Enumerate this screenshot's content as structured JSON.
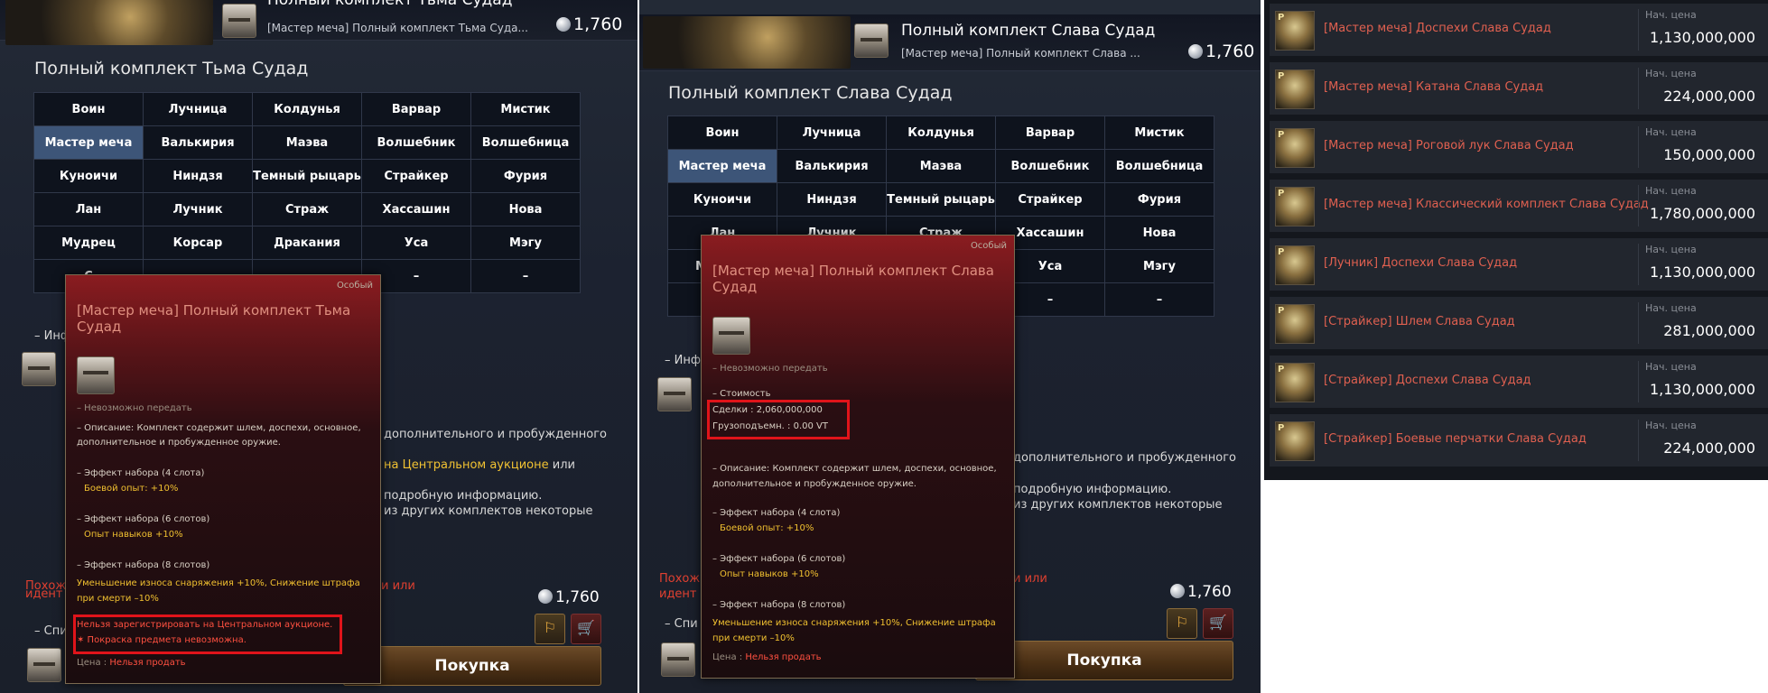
{
  "left_panel": {
    "top_name": "Полный комплект Тьма Судад",
    "top_sub": "[Мастер меча] Полный комплект Тьма Суда...",
    "top_price": "1,760",
    "set_title": "Полный комплект Тьма Судад",
    "classes": [
      [
        "Воин",
        "Лучница",
        "Колдунья",
        "Варвар",
        "Мистик"
      ],
      [
        "Мастер меча",
        "Валькирия",
        "Маэва",
        "Волшебник",
        "Волшебница"
      ],
      [
        "Куноичи",
        "Ниндзя",
        "Темный рыцарь",
        "Страйкер",
        "Фурия"
      ],
      [
        "Лан",
        "Лучник",
        "Страж",
        "Хассашин",
        "Нова"
      ],
      [
        "Мудрец",
        "Корсар",
        "Дракания",
        "Уса",
        "Мэгу"
      ],
      [
        "С",
        "",
        "",
        "–",
        "–"
      ]
    ],
    "info_label": "– Инф",
    "side_text_1": "дополнительного и пробужденного",
    "side_text_2a": "на Центральном аукционе",
    "side_text_2b": "или",
    "side_text_3": "подробную информацию.",
    "side_text_4": "из других комплектов некоторые",
    "similar_1": "Похож",
    "similar_1b": "и или",
    "similar_2": "идент",
    "list_label": "– Спи",
    "bottom_price": "1,760",
    "buy_label": "Покупка",
    "tooltip": {
      "special": "Особый",
      "title": "[Мастер меча] Полный комплект Тьма Судад",
      "no_transfer": "– Невозможно передать",
      "description": "– Описание: Комплект содержит шлем, доспехи, основное, дополнительное и пробужденное оружие.",
      "set4_header": "– Эффект набора (4 слота)",
      "set4_effect": "Боевой опыт: +10%",
      "set6_header": "– Эффект набора (6 слотов)",
      "set6_effect": "Опыт навыков +10%",
      "set8_header": "– Эффект набора (8 слотов)",
      "set8_effect": "Уменьшение износа снаряжения +10%, Снижение штрафа при смерти –10%",
      "warn_1": "Нельзя зарегистрировать на Центральном аукционе.",
      "warn_2": "✶ Покраска предмета невозможна.",
      "price_label": "Цена :",
      "price_value": "Нельзя продать"
    }
  },
  "middle_panel": {
    "top_name": "Полный комплект Слава Судад",
    "top_sub": "[Мастер меча] Полный комплект Слава ...",
    "top_price": "1,760",
    "set_title": "Полный комплект Слава Судад",
    "classes": [
      [
        "Воин",
        "Лучница",
        "Колдунья",
        "Варвар",
        "Мистик"
      ],
      [
        "Мастер меча",
        "Валькирия",
        "Маэва",
        "Волшебник",
        "Волшебница"
      ],
      [
        "Куноичи",
        "Ниндзя",
        "Темный рыцарь",
        "Страйкер",
        "Фурия"
      ],
      [
        "Лан",
        "Лучник",
        "Страж",
        "Хассашин",
        "Нова"
      ],
      [
        "Мудрец",
        "Корсар",
        "Дракания",
        "Уса",
        "Мэгу"
      ],
      [
        "С",
        "",
        "",
        "–",
        "–"
      ]
    ],
    "info_label": "– Инф",
    "side_text_1": "дополнительного и пробужденного",
    "side_text_3": "подробную информацию.",
    "side_text_4": "из других комплектов некоторые",
    "similar_1": "Похож",
    "similar_1b": "и или",
    "similar_2": "идент",
    "list_label": "– Спи",
    "bottom_price": "1,760",
    "buy_label": "Покупка",
    "tooltip": {
      "special": "Особый",
      "title": "[Мастер меча] Полный комплект Слава Судад",
      "no_transfer": "– Невозможно передать",
      "cost_header": "– Стоимость",
      "deals": "Сделки : 2,060,000,000",
      "weight": "Грузоподъемн. : 0.00 VT",
      "description": "– Описание: Комплект содержит шлем, доспехи, основное, дополнительное и пробужденное оружие.",
      "set4_header": "– Эффект набора (4 слота)",
      "set4_effect": "Боевой опыт: +10%",
      "set6_header": "– Эффект набора (6 слотов)",
      "set6_effect": "Опыт навыков +10%",
      "set8_header": "– Эффект набора (8 слотов)",
      "set8_effect": "Уменьшение износа снаряжения +10%, Снижение штрафа при смерти –10%",
      "price_label": "Цена :",
      "price_value": "Нельзя продать"
    }
  },
  "market_list": {
    "price_label": "Нач. цена",
    "items": [
      {
        "name": "[Мастер меча] Доспехи Слава Судад",
        "price": "1,130,000,000"
      },
      {
        "name": "[Мастер меча] Катана Слава Судад",
        "price": "224,000,000"
      },
      {
        "name": "[Мастер меча] Роговой лук Слава Судад",
        "price": "150,000,000"
      },
      {
        "name": "[Мастер меча] Классический комплект Слава Судад",
        "price": "1,780,000,000"
      },
      {
        "name": "[Лучник] Доспехи Слава Судад",
        "price": "1,130,000,000"
      },
      {
        "name": "[Страйкер] Шлем Слава Судад",
        "price": "281,000,000"
      },
      {
        "name": "[Страйкер] Доспехи Слава Судад",
        "price": "1,130,000,000"
      },
      {
        "name": "[Страйкер] Боевые перчатки Слава Судад",
        "price": "224,000,000"
      }
    ]
  }
}
